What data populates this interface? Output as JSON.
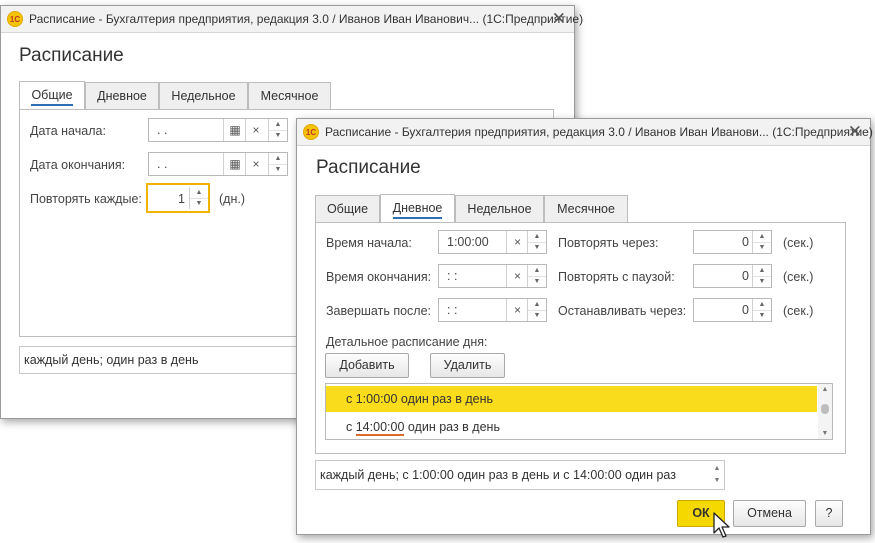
{
  "back_window": {
    "title": "Расписание - Бухгалтерия предприятия, редакция 3.0 / Иванов Иван Иванович...  (1С:Предприятие)",
    "heading": "Расписание",
    "tabs": [
      {
        "label": "Общие"
      },
      {
        "label": "Дневное"
      },
      {
        "label": "Недельное"
      },
      {
        "label": "Месячное"
      }
    ],
    "active_tab": "Общие",
    "start_date_label": "Дата начала:",
    "start_date_value": " .  .",
    "end_date_label": "Дата окончания:",
    "end_date_value": " .  .",
    "repeat_label": "Повторять каждые:",
    "repeat_value": "1",
    "repeat_unit": "(дн.)",
    "summary": "каждый  день; один раз в день"
  },
  "front_window": {
    "title": "Расписание - Бухгалтерия предприятия, редакция 3.0 / Иванов Иван Иванови...  (1С:Предприятие)",
    "heading": "Расписание",
    "tabs": [
      {
        "label": "Общие"
      },
      {
        "label": "Дневное"
      },
      {
        "label": "Недельное"
      },
      {
        "label": "Месячное"
      }
    ],
    "active_tab": "Дневное",
    "start_time_label": "Время начала:",
    "start_time_value": "1:00:00",
    "end_time_label": "Время окончания:",
    "end_time_value": " :  :",
    "finish_after_label": "Завершать после:",
    "finish_after_value": " :  :",
    "repeat_every_label": "Повторять через:",
    "repeat_every_value": "0",
    "repeat_pause_label": "Повторять с паузой:",
    "repeat_pause_value": "0",
    "stop_after_label": "Останавливать через:",
    "stop_after_value": "0",
    "unit_sec": "(сек.)",
    "detail_label": "Детальное расписание дня:",
    "add_button": "Добавить",
    "delete_button": "Удалить",
    "rows": [
      {
        "prefix": "с ",
        "time": "1:00:00",
        "suffix": " один раз в день"
      },
      {
        "prefix": "с ",
        "time": "14:00:00",
        "suffix": " один раз в день"
      }
    ],
    "summary": "каждый  день; с 1:00:00 один раз в день и с 14:00:00 один раз",
    "ok_button": "ОК",
    "cancel_button": "Отмена",
    "help_button": "?"
  },
  "icons": {
    "close": "close-icon",
    "calendar": "calendar-icon",
    "clear": "clear-icon",
    "spin": "spin-icon",
    "logo": "1c-logo-icon"
  },
  "colors": {
    "accent": "#f9dc1c",
    "ok_button": "#f5d800",
    "tab_underline": "#2f6fb5",
    "focus_border": "#f0b400",
    "time_underline": "#e06a2c"
  }
}
